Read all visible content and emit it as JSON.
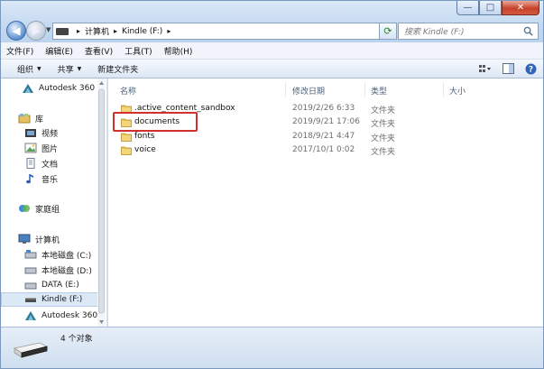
{
  "window": {
    "caption": {
      "minimize": "—",
      "maximize": "□",
      "close": "✕"
    }
  },
  "address": {
    "crumbs": [
      "计算机",
      "Kindle (F:)"
    ],
    "separator": "▸",
    "search_placeholder": "搜索 Kindle (F:)"
  },
  "menu": [
    "文件(F)",
    "编辑(E)",
    "查看(V)",
    "工具(T)",
    "帮助(H)"
  ],
  "toolbar": {
    "organize": "组织",
    "share": "共享",
    "new_folder": "新建文件夹",
    "icons": [
      "view-options-icon",
      "preview-pane-icon",
      "help-icon"
    ]
  },
  "nav": {
    "items": [
      {
        "label": "Autodesk 360",
        "icon": "autodesk-icon"
      },
      {
        "label": "库",
        "icon": "library-icon"
      },
      {
        "label": "视频",
        "icon": "video-icon"
      },
      {
        "label": "图片",
        "icon": "pictures-icon"
      },
      {
        "label": "文档",
        "icon": "documents-icon"
      },
      {
        "label": "音乐",
        "icon": "music-icon"
      },
      {
        "label": "家庭组",
        "icon": "homegroup-icon"
      },
      {
        "label": "计算机",
        "icon": "computer-icon"
      },
      {
        "label": "本地磁盘 (C:)",
        "icon": "drive-icon"
      },
      {
        "label": "本地磁盘 (D:)",
        "icon": "drive-icon"
      },
      {
        "label": "DATA (E:)",
        "icon": "drive-icon"
      },
      {
        "label": "Kindle (F:)",
        "icon": "usb-drive-icon",
        "selected": true
      },
      {
        "label": "Autodesk 360",
        "icon": "autodesk-icon"
      }
    ]
  },
  "columns": {
    "name": "名称",
    "modified": "修改日期",
    "type": "类型",
    "size": "大小"
  },
  "files": [
    {
      "name": ".active_content_sandbox",
      "modified": "2019/2/26 6:33",
      "type": "文件夹"
    },
    {
      "name": "documents",
      "modified": "2019/9/21 17:06",
      "type": "文件夹"
    },
    {
      "name": "fonts",
      "modified": "2018/9/21 4:47",
      "type": "文件夹"
    },
    {
      "name": "voice",
      "modified": "2017/10/1 0:02",
      "type": "文件夹"
    }
  ],
  "status": {
    "count": "4 个对象"
  },
  "colors": {
    "highlight": "#d0312d",
    "selected_bg": "#dbe8f6"
  }
}
